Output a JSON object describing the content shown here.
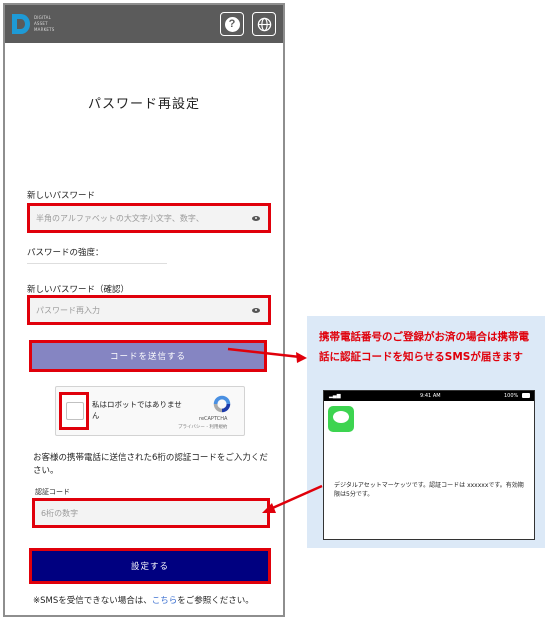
{
  "header": {
    "logo_text": [
      "DIGITAL",
      "ASSET",
      "MARKETS"
    ],
    "help_label": "?",
    "colors": {
      "header_bg": "#5b5b5b",
      "primary": "#000080",
      "send_button": "#8585c2",
      "highlight": "#e0000b",
      "callout_bg": "#dce9f7"
    }
  },
  "form": {
    "title": "パスワード再設定",
    "new_password_label": "新しいパスワード",
    "new_password_placeholder": "半角のアルファベットの大文字小文字、数字、",
    "strength_label": "パスワードの強度：",
    "confirm_password_label": "新しいパスワード（確認）",
    "confirm_password_placeholder": "パスワード再入力",
    "send_code_button": "コードを送信する",
    "captcha_label": "私はロボットではありません",
    "captcha_brand": "reCAPTCHA",
    "captcha_links": "プライバシー - 利用規約",
    "instructions": "お客様の携帯電話に送信された6桁の認証コードをご入力ください。",
    "code_label": "認証コード",
    "code_placeholder": "6桁の数字",
    "submit_button": "設定する",
    "sms_note_prefix": "※SMSを受信できない場合は、",
    "sms_note_link": "こちら",
    "sms_note_suffix": "をご参照ください。"
  },
  "callout": {
    "text": "携帯電話番号のご登録がお済の場合は携帯電話に認証コードを知らせるSMSが届きます",
    "phone_time": "9:41 AM",
    "phone_battery": "100%",
    "sms_message": "デジタルアセットマーケッツです。認証コードは xxxxxxです。有効期限は5分です。"
  }
}
